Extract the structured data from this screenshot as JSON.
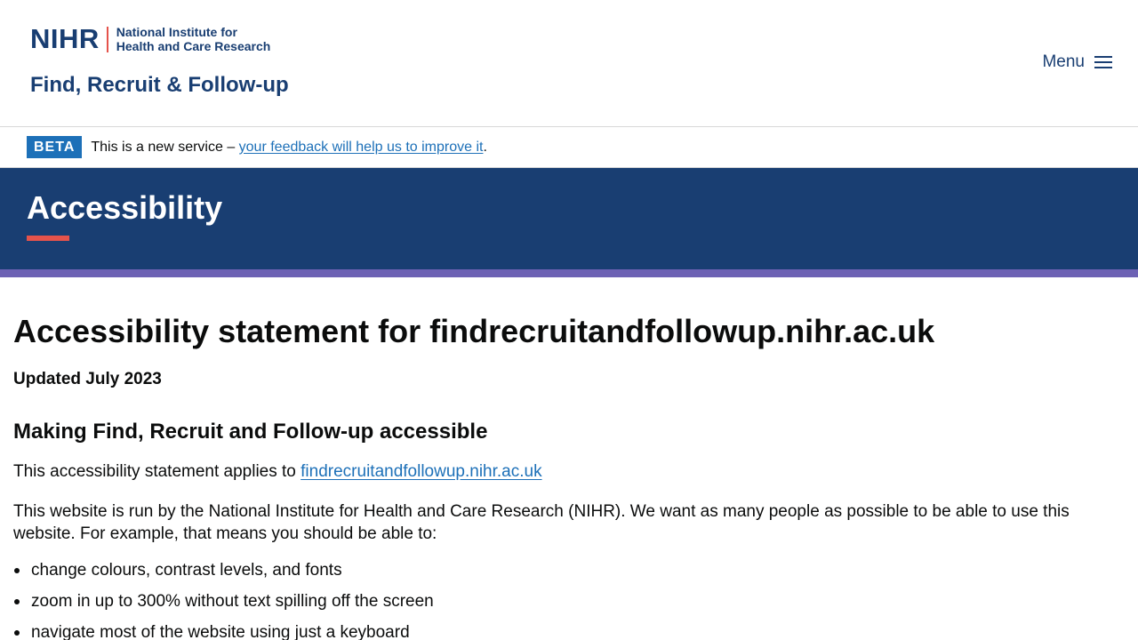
{
  "header": {
    "logo_mark": "NIHR",
    "logo_line1": "National Institute for",
    "logo_line2": "Health and Care Research",
    "service_name": "Find, Recruit & Follow-up",
    "menu_label": "Menu",
    "menu_icon": "hamburger-icon"
  },
  "beta_banner": {
    "tag": "BETA",
    "text": "This is a new service – ",
    "link_text": "your feedback will help us to improve it",
    "suffix": "."
  },
  "hero": {
    "title": "Accessibility"
  },
  "main": {
    "heading": "Accessibility statement for findrecruitandfollowup.nihr.ac.uk",
    "updated": "Updated July 2023",
    "section_heading": "Making Find, Recruit and Follow-up accessible",
    "applies_prefix": "This accessibility statement applies to ",
    "applies_link": "findrecruitandfollowup.nihr.ac.uk",
    "intro": "This website is run by the National Institute for Health and Care Research (NIHR). We want as many people as possible to be able to use this website. For example, that means you should be able to:",
    "bullets": [
      "change colours, contrast levels, and fonts",
      "zoom in up to 300% without text spilling off the screen",
      "navigate most of the website using just a keyboard"
    ]
  },
  "colors": {
    "brand_navy": "#193e72",
    "accent_red": "#e5534b",
    "stripe_purple": "#6d62b4",
    "link_blue": "#1d70b8"
  }
}
